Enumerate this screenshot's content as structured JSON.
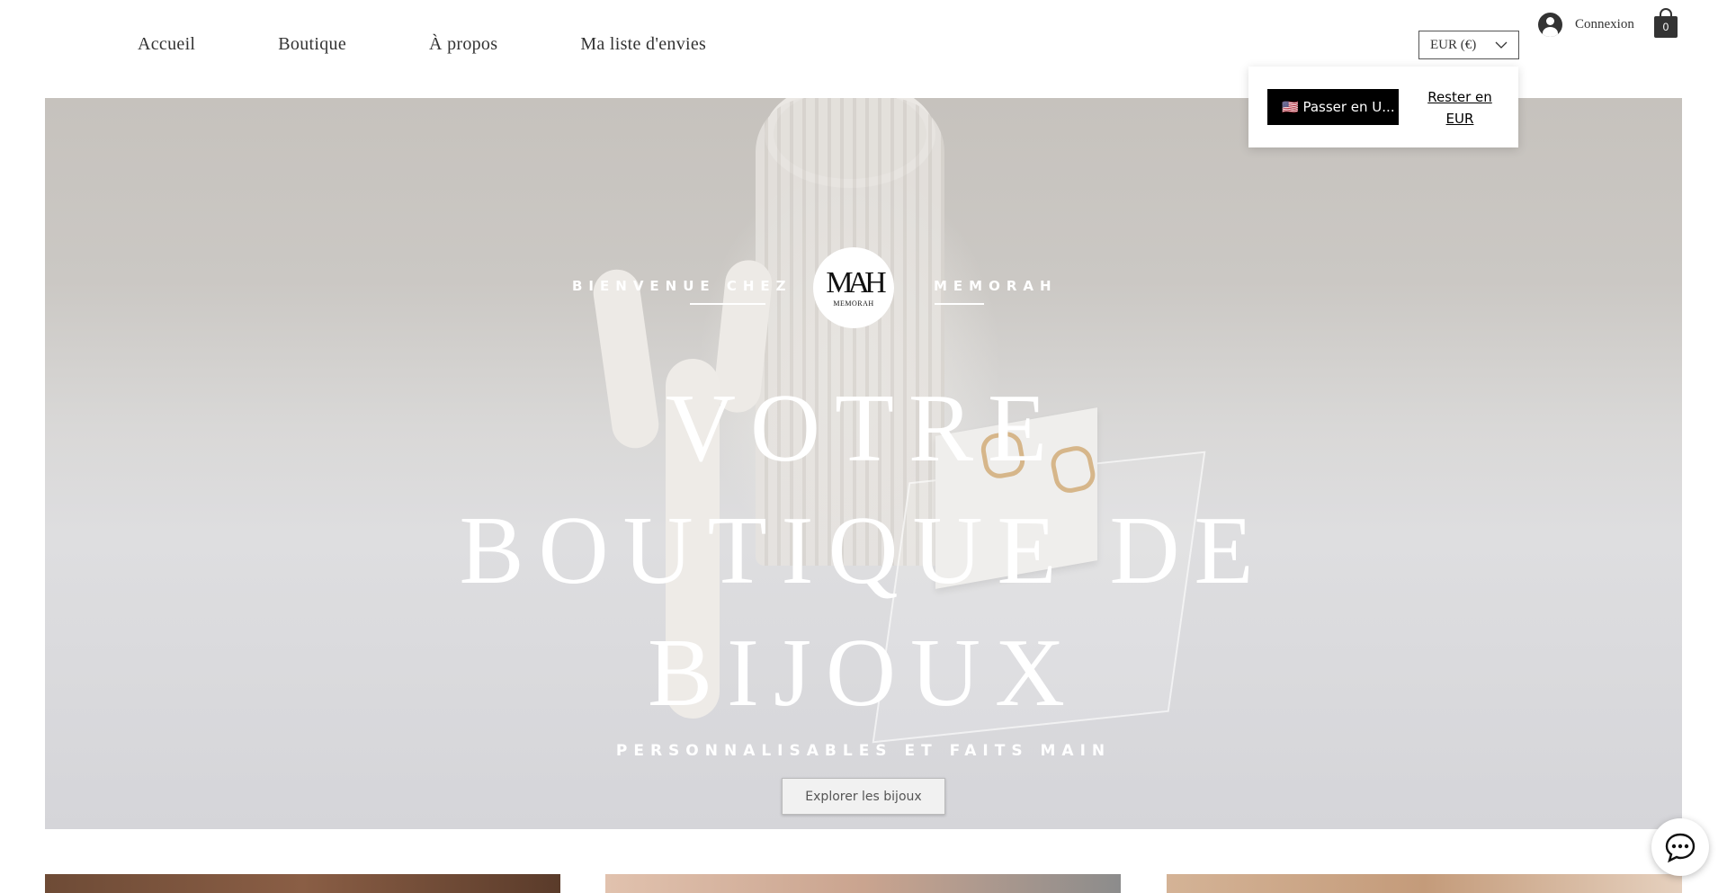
{
  "nav": {
    "items": [
      "Accueil",
      "Boutique",
      "À propos",
      "Ma liste d'envies"
    ]
  },
  "header": {
    "currency_label": "EUR (€)",
    "login_label": "Connexion",
    "cart_count": "0",
    "icons": [
      "user-avatar-icon",
      "shopping-bag-icon",
      "chevron-down-icon"
    ]
  },
  "currency_popup": {
    "switch_label": "🇺🇸 Passer en U...",
    "stay_label": "Rester en EUR"
  },
  "hero": {
    "welcome_left": "BIENVENUE CHEZ",
    "welcome_right": "MEMORAH",
    "logo_mark": "MAH",
    "logo_name": "MEMORAH",
    "title_lines": [
      "VOTRE",
      "BOUTIQUE DE",
      "BIJOUX"
    ],
    "tagline": "PERSONNALISABLES ET FAITS MAIN",
    "cta_label": "Explorer les bijoux"
  },
  "chat": {
    "icon": "chat-bubble-icon"
  },
  "colors": {
    "text_dark": "#333333",
    "popup_button_bg": "#000000",
    "hero_text": "#ffffff"
  }
}
